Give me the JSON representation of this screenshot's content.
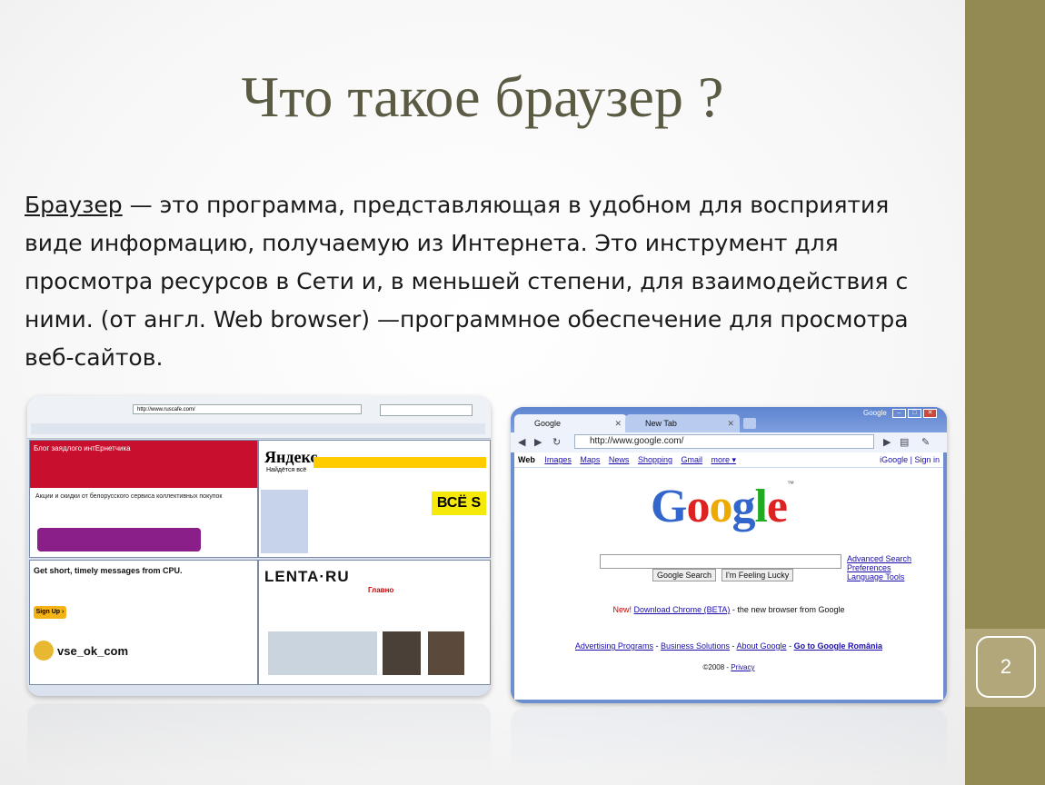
{
  "slide": {
    "title": "Что такое браузер ?",
    "page_number": "2",
    "paragraph": {
      "term": "Браузер",
      "text": " — это программа, представляющая в удобном для восприятия виде информацию, получаемую из Интернета. Это инструмент для просмотра ресурсов в Сети и, в меньшей степени, для взаимодействия с ними. (от англ. Web browser) —программное обеспечение для просмотра веб-сайтов."
    }
  },
  "screenshot1": {
    "address": "http://www.ruscafe.com/",
    "yandex_logo": "Яндекс",
    "yandex_tagline": "Найдётся всё",
    "yandex_banner": "ВСЁ S",
    "blog_title": "Блог заядлого интЕрнетчика",
    "blog_news": "Акции и скидки от белорусского сервиса коллективных покупок",
    "twitter_heading": "Get short, timely messages from CPU.",
    "twitter_signup": "Sign Up ›",
    "twitter_name": "vse_ok_com",
    "lenta_logo": "LENTA·RU",
    "lenta_main": "Главно"
  },
  "screenshot2": {
    "window_title": "Google",
    "tabs": [
      {
        "label": "Google"
      },
      {
        "label": "New Tab"
      }
    ],
    "url": "http://www.google.com/",
    "top_links": [
      "Web",
      "Images",
      "Maps",
      "News",
      "Shopping",
      "Gmail",
      "more ▾"
    ],
    "top_right": "iGoogle | Sign in",
    "logo_letters": [
      "G",
      "o",
      "o",
      "g",
      "l",
      "e"
    ],
    "logo_tm": "™",
    "buttons": {
      "search": "Google Search",
      "lucky": "I'm Feeling Lucky"
    },
    "side_links": [
      "Advanced Search",
      "Preferences",
      "Language Tools"
    ],
    "promo": {
      "new": "New!",
      "link": "Download Chrome (BETA)",
      "rest": " - the new browser from Google"
    },
    "footer_links": [
      "Advertising Programs",
      "Business Solutions",
      "About Google",
      "Go to Google România"
    ],
    "copyright": "©2008 - ",
    "privacy": "Privacy"
  },
  "colors": {
    "sidebar": "#938953",
    "title": "#5b5a43",
    "page_badge": "#b1a77a"
  }
}
